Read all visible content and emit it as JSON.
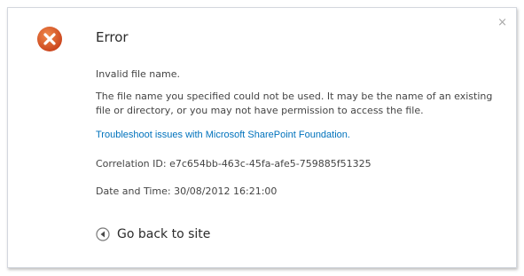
{
  "dialog": {
    "close_symbol": "×",
    "icon": "error-x-icon",
    "title": "Error",
    "message_short": "Invalid file name.",
    "message_long": "The file name you specified could not be used.  It may be the name of an existing file or directory, or you may not have permission to access the file.",
    "troubleshoot_link": "Troubleshoot issues with Microsoft SharePoint Foundation.",
    "correlation_id": "Correlation ID: e7c654bb-463c-45fa-afe5-759885f51325",
    "date_time": "Date and Time: 30/08/2012 16:21:00",
    "go_back_label": "Go back to site",
    "go_back_icon": "back-arrow-icon"
  },
  "colors": {
    "error_icon": "#d9531e",
    "link": "#0072bc",
    "text": "#444444"
  }
}
